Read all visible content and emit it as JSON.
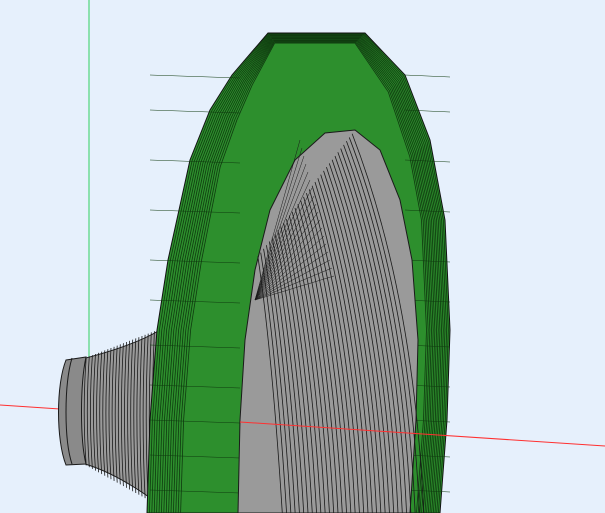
{
  "viewport": {
    "background": "#e6f0fc",
    "axis_colors": {
      "x_axis": "#ff3030",
      "y_axis": "#30d060"
    }
  },
  "model": {
    "shading": "faceted",
    "edge_color": "#111111",
    "flange_color": "#2d8f2d",
    "flange_edge_color": "#0f3a0f",
    "cone_color": "#9a9a9a",
    "cone_edge_color": "#1a1a1a",
    "collar_color": "#8a8a8a"
  }
}
